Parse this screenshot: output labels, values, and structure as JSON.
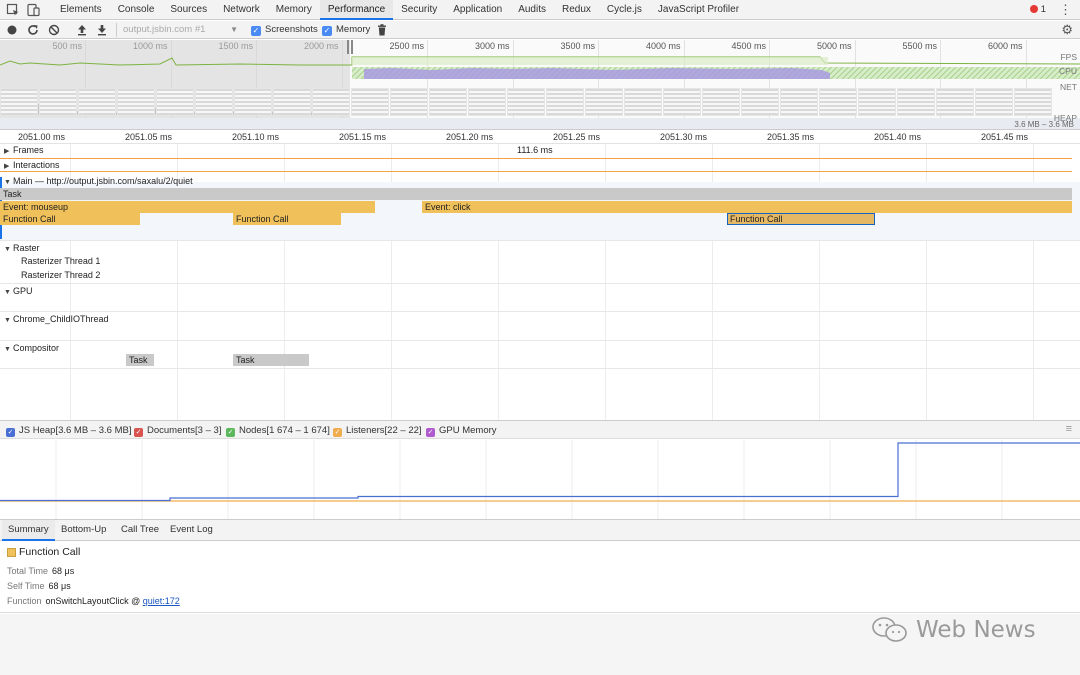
{
  "tabs": [
    "Elements",
    "Console",
    "Sources",
    "Network",
    "Memory",
    "Performance",
    "Security",
    "Application",
    "Audits",
    "Redux",
    "Cycle.js",
    "JavaScript Profiler"
  ],
  "active_tab": "Performance",
  "error_count": "1",
  "toolbar": {
    "recording_select": "output.jsbin.com #1",
    "screenshots_label": "Screenshots",
    "memory_label": "Memory"
  },
  "overview": {
    "ticks": [
      "500 ms",
      "1000 ms",
      "1500 ms",
      "2000 ms",
      "2500 ms",
      "3000 ms",
      "3500 ms",
      "4000 ms",
      "4500 ms",
      "5000 ms",
      "5500 ms",
      "6000 ms",
      "6"
    ],
    "lanes": [
      "FPS",
      "CPU",
      "NET",
      "HEAP"
    ],
    "heap_range": "3.6 MB – 3.6 MB"
  },
  "ruler": [
    "2051.00 ms",
    "2051.05 ms",
    "2051.10 ms",
    "2051.15 ms",
    "2051.20 ms",
    "2051.25 ms",
    "2051.30 ms",
    "2051.35 ms",
    "2051.40 ms",
    "2051.45 ms"
  ],
  "tracks": {
    "frames": "Frames",
    "frame_duration": "111.6 ms",
    "interactions": "Interactions",
    "main": "Main — http://output.jsbin.com/saxalu/2/quiet",
    "raster": "Raster",
    "raster_thread_1": "Rasterizer Thread 1",
    "raster_thread_2": "Rasterizer Thread 2",
    "gpu": "GPU",
    "child_io": "Chrome_ChildIOThread",
    "compositor": "Compositor"
  },
  "flame_events": {
    "task": "Task",
    "mouseup": "Event: mouseup",
    "click": "Event: click",
    "fc1": "Function Call",
    "fc2": "Function Call",
    "fc3": "Function Call",
    "comp_task1": "Task",
    "comp_task2": "Task"
  },
  "counters": {
    "js_heap": "JS Heap[3.6 MB – 3.6 MB]",
    "documents": "Documents[3 – 3]",
    "nodes": "Nodes[1 674 – 1 674]",
    "listeners": "Listeners[22 – 22]",
    "gpu_memory": "GPU Memory"
  },
  "colors": {
    "js_heap": "#4a6fd4",
    "documents": "#d9534f",
    "nodes": "#5cb85c",
    "listeners": "#f0ad4e",
    "gpu_memory": "#b05ad0",
    "function_call": "#f0c15a",
    "task": "#c9c9c9",
    "selection": "#1565c0"
  },
  "detail_tabs": [
    "Summary",
    "Bottom-Up",
    "Call Tree",
    "Event Log"
  ],
  "active_detail_tab": "Summary",
  "summary": {
    "title": "Function Call",
    "total_time_label": "Total Time",
    "total_time": "68 μs",
    "self_time_label": "Self Time",
    "self_time": "68 μs",
    "function_label": "Function",
    "function_name": "onSwitchLayoutClick @ ",
    "function_link": "quiet:172"
  },
  "watermark": "Web News",
  "icons": [
    "inspect-icon",
    "device-icon",
    "record-icon",
    "reload-icon",
    "clear-icon",
    "upload-icon",
    "download-icon",
    "trash-icon",
    "gear-icon",
    "more-icon",
    "wechat-icon"
  ]
}
